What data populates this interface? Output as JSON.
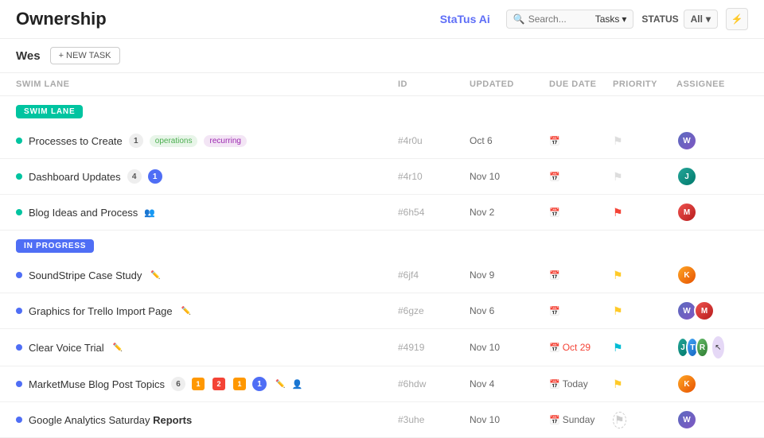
{
  "header": {
    "title": "Ownership",
    "search_placeholder": "Search...",
    "tasks_label": "Tasks",
    "status_label": "STATUS",
    "status_value": "All",
    "filter_icon": "filter",
    "status_ai": "StaTus Ai"
  },
  "sub_header": {
    "user": "Wes",
    "new_task_label": "+ NEW TASK"
  },
  "table": {
    "columns": [
      "SWIM LANE",
      "ID",
      "UPDATED",
      "DUE DATE",
      "PRIORITY",
      "ASSIGNEE"
    ],
    "sections": [
      {
        "label": "SWIM LANE",
        "type": "swim",
        "tasks": [
          {
            "name": "Processes to Create",
            "badge_count": "1",
            "badge_type": "gray",
            "tags": [
              "operations",
              "recurring"
            ],
            "id": "#4r0u",
            "updated": "Oct 6",
            "due_date": "",
            "due_overdue": false,
            "priority": "none",
            "assignees": [
              "1"
            ],
            "icons": []
          },
          {
            "name": "Dashboard Updates",
            "badge_count": "4",
            "badge_type": "gray",
            "badge_extra": "1",
            "badge_extra_type": "blue",
            "tags": [],
            "id": "#4r10",
            "updated": "Nov 10",
            "due_date": "",
            "due_overdue": false,
            "priority": "none",
            "assignees": [
              "2"
            ],
            "icons": []
          },
          {
            "name": "Blog Ideas and Process",
            "badge_count": "",
            "tags": [],
            "id": "#6h54",
            "updated": "Nov 2",
            "due_date": "",
            "due_overdue": false,
            "priority": "red",
            "assignees": [
              "3"
            ],
            "icons": [
              "people"
            ]
          }
        ]
      },
      {
        "label": "IN PROGRESS",
        "type": "inprogress",
        "tasks": [
          {
            "name": "SoundStripe Case Study",
            "tags": [],
            "id": "#6jf4",
            "updated": "Nov 9",
            "due_date": "",
            "due_overdue": false,
            "priority": "yellow",
            "assignees": [
              "4"
            ],
            "has_edit": true
          },
          {
            "name": "Graphics for Trello Import Page",
            "tags": [],
            "id": "#6gze",
            "updated": "Nov 6",
            "due_date": "",
            "due_overdue": false,
            "priority": "yellow",
            "assignees": [
              "1",
              "3"
            ],
            "has_edit": true
          },
          {
            "name": "Clear Voice Trial",
            "tags": [],
            "id": "#4919",
            "updated": "Nov 10",
            "due_date": "Oct 29",
            "due_overdue": true,
            "priority": "cyan",
            "assignees": [
              "2",
              "5",
              "6"
            ],
            "has_edit": true,
            "has_cursor": true
          },
          {
            "name": "MarketMuse Blog Post Topics",
            "tags": [],
            "id": "#6hdw",
            "updated": "Nov 4",
            "due_date": "Today",
            "due_overdue": false,
            "priority": "yellow",
            "assignees": [
              "4"
            ],
            "has_edit": true,
            "has_person": true,
            "badges_row": true
          },
          {
            "name": "Google Analytics Saturday Reports",
            "tags": [],
            "id": "#3uhe",
            "updated": "Nov 10",
            "due_date": "Sunday",
            "due_overdue": false,
            "priority": "none_dashed",
            "assignees": [
              "1"
            ],
            "has_edit": false
          }
        ]
      }
    ]
  }
}
